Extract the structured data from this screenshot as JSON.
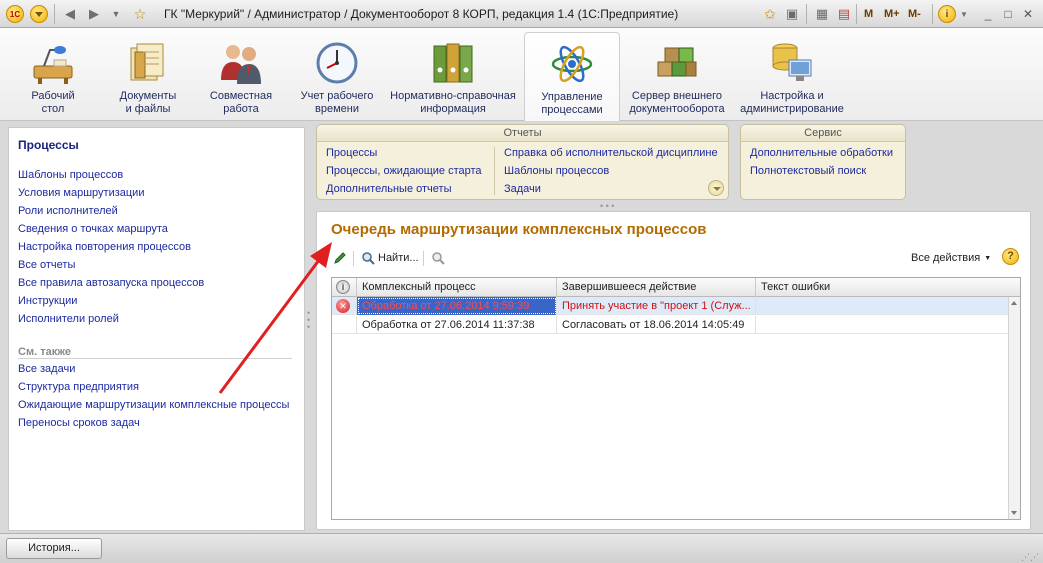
{
  "window": {
    "title": "ГК \"Меркурий\" / Администратор / Документооборот 8 КОРП, редакция 1.4  (1С:Предприятие)",
    "logo": "1С",
    "right_tools": [
      "M",
      "M+",
      "M-"
    ]
  },
  "sections": [
    {
      "label": "Рабочий\nстол",
      "icon": "desk-icon",
      "active": false
    },
    {
      "label": "Документы\nи файлы",
      "icon": "documents-icon",
      "active": false
    },
    {
      "label": "Совместная\nработа",
      "icon": "people-icon",
      "active": false
    },
    {
      "label": "Учет рабочего\nвремени",
      "icon": "clock-icon",
      "active": false
    },
    {
      "label": "Нормативно-справочная\nинформация",
      "icon": "binders-icon",
      "active": false
    },
    {
      "label": "Управление\nпроцессами",
      "icon": "atom-icon",
      "active": true
    },
    {
      "label": "Сервер внешнего\nдокументооборота",
      "icon": "cubes-icon",
      "active": false
    },
    {
      "label": "Настройка и\nадминистрирование",
      "icon": "database-computer-icon",
      "active": false
    }
  ],
  "left_pane": {
    "heading": "Процессы",
    "links": [
      "Шаблоны процессов",
      "Условия маршрутизации",
      "Роли исполнителей",
      "Сведения о точках маршрута",
      "Настройка повторения процессов",
      "Все отчеты",
      "Все правила автозапуска процессов",
      "Инструкции",
      "Исполнители ролей"
    ],
    "see_also_title": "См. также",
    "see_also": [
      "Все задачи",
      "Структура предприятия",
      "Ожидающие маршрутизации комплексные процессы",
      "Переносы сроков задач"
    ]
  },
  "reports": {
    "title": "Отчеты",
    "col1": [
      "Процессы",
      "Процессы, ожидающие старта",
      "Дополнительные отчеты"
    ],
    "col2": [
      "Справка об исполнительской дисциплине",
      "Шаблоны процессов",
      "Задачи"
    ]
  },
  "service": {
    "title": "Сервис",
    "links": [
      "Дополнительные обработки",
      "Полнотекстовый поиск"
    ]
  },
  "form": {
    "title": "Очередь маршрутизации комплексных процессов",
    "find_label": "Найти...",
    "all_actions_label": "Все действия",
    "help_label": "?",
    "columns": [
      "Комплексный процесс",
      "Завершившееся действие",
      "Текст ошибки"
    ],
    "rows": [
      {
        "status": "error",
        "process": "Обработка от 27.06.2014 9:59:39",
        "action": "Принять участие в \"проект 1 (Служ...",
        "error": ""
      },
      {
        "status": "none",
        "process": "Обработка от 27.06.2014 11:37:38",
        "action": "Согласовать от 18.06.2014 14:05:49",
        "error": ""
      }
    ]
  },
  "statusbar": {
    "history_label": "История..."
  }
}
